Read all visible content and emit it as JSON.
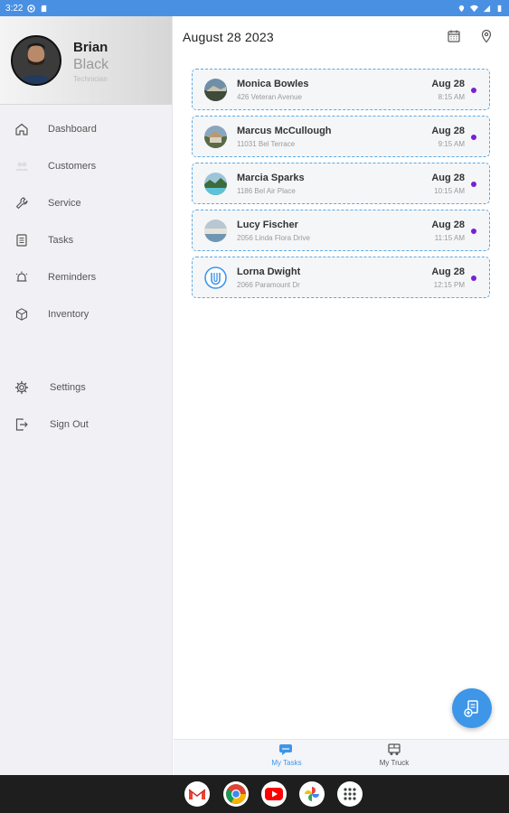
{
  "status_bar": {
    "time": "3:22"
  },
  "profile": {
    "first_name": "Brian",
    "last_name": "Black",
    "role": "Technician"
  },
  "sidebar": {
    "items": [
      {
        "label": "Dashboard",
        "icon": "home-icon"
      },
      {
        "label": "Customers",
        "icon": "customers-icon"
      },
      {
        "label": "Service",
        "icon": "wrench-icon"
      },
      {
        "label": "Tasks",
        "icon": "tasks-icon"
      },
      {
        "label": "Reminders",
        "icon": "alarm-icon"
      },
      {
        "label": "Inventory",
        "icon": "box-icon"
      }
    ],
    "secondary": [
      {
        "label": "Settings",
        "icon": "gear-icon"
      },
      {
        "label": "Sign Out",
        "icon": "sign-out-icon"
      }
    ]
  },
  "header": {
    "date": "August 28 2023"
  },
  "tasks": [
    {
      "name": "Monica Bowles",
      "address": "426 Veteran Avenue",
      "date": "Aug 28",
      "time": "8:15 AM"
    },
    {
      "name": "Marcus McCullough",
      "address": "11031 Bel Terrace",
      "date": "Aug 28",
      "time": "9:15 AM"
    },
    {
      "name": "Marcia Sparks",
      "address": "1186 Bel Air Place",
      "date": "Aug 28",
      "time": "10:15 AM"
    },
    {
      "name": "Lucy Fischer",
      "address": "2056 Linda Flora Drive",
      "date": "Aug 28",
      "time": "11:15 AM"
    },
    {
      "name": "Lorna Dwight",
      "address": "2066 Paramount Dr",
      "date": "Aug 28",
      "time": "12:15 PM"
    }
  ],
  "bottom_nav": {
    "tab1": "My Tasks",
    "tab2": "My Truck"
  },
  "colors": {
    "accent": "#3d96e8",
    "status_dot": "#7a1fd6",
    "status_bar": "#4a90e2"
  }
}
